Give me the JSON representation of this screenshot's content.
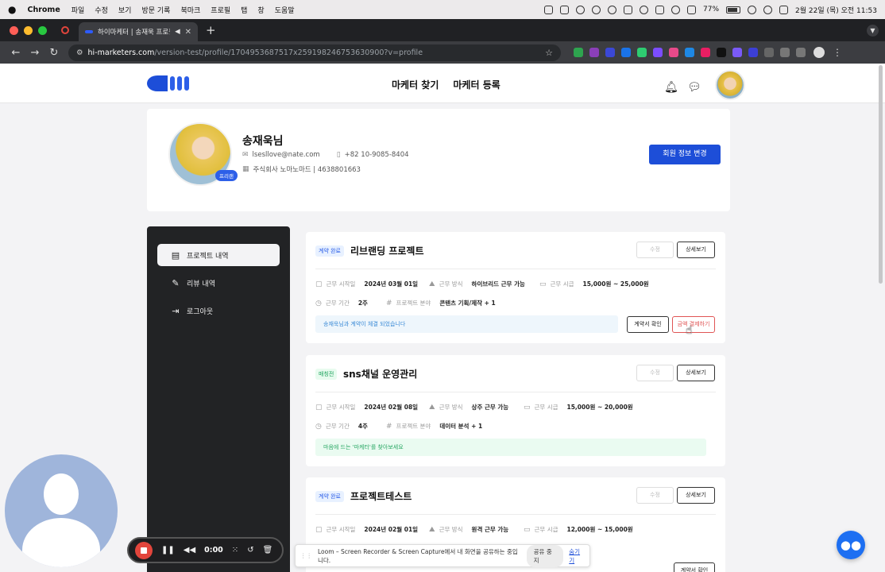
{
  "menubar": {
    "app": "Chrome",
    "items": [
      "파일",
      "수정",
      "보기",
      "방문 기록",
      "북마크",
      "프로필",
      "탭",
      "창",
      "도움말"
    ],
    "battery": "77%",
    "clock": "2월 22일 (목) 오전 11:53"
  },
  "browser": {
    "tab_title": "하이마케터 | 송재욱 프로필",
    "url_host": "hi-marketers.com",
    "url_rest": "/version-test/profile/1704953687517x259198246753630900?v=profile"
  },
  "header": {
    "nav": [
      "마케터 찾기",
      "마케터 등록"
    ]
  },
  "profile": {
    "name": "송재욱님",
    "email": "lsesllove@nate.com",
    "phone": "+82 10-9085-8404",
    "company": "주식회사 노마노마드 | 4638801663",
    "badge": "프리랜",
    "edit_button": "회원 정보 변경"
  },
  "sidebar": {
    "items": [
      {
        "label": "프로젝트 내역",
        "icon": "document-icon"
      },
      {
        "label": "리뷰 내역",
        "icon": "pencil-icon"
      },
      {
        "label": "로그아웃",
        "icon": "logout-icon"
      }
    ]
  },
  "labels": {
    "start_date": "근무 시작일",
    "work_type": "근무 방식",
    "hourly_rate": "근무 시급",
    "duration": "근무 기간",
    "field": "프로젝트 분야",
    "edit": "수정",
    "detail": "상세보기",
    "contract": "계약서 확인",
    "pay": "금액 결제하기"
  },
  "projects": [
    {
      "status": "계약 완료",
      "title": "리브랜딩 프로젝트",
      "start_date": "2024년 03월 01일",
      "work_type": "하이브리드 근무 가능",
      "rate": "15,000원 ~ 25,000원",
      "duration": "2주",
      "field": "콘텐츠 기획/제작 + 1",
      "notice": "송재욱님과 계약이 체결 되었습니다"
    },
    {
      "status": "매칭전",
      "title": "sns채널 운영관리",
      "start_date": "2024년 02월 08일",
      "work_type": "상주 근무 가능",
      "rate": "15,000원 ~ 20,000원",
      "duration": "4주",
      "field": "데이터 분석 + 1",
      "notice": "마음에 드는 '마케터'를 찾아보세요"
    },
    {
      "status": "계약 완료",
      "title": "프로젝트테스트",
      "start_date": "2024년 02월 01일",
      "work_type": "원격 근무 가능",
      "rate": "12,000원 ~ 15,000원"
    }
  ],
  "loom": {
    "timer": "0:00",
    "share_message": "Loom – Screen Recorder & Screen Capture에서 내 화면을 공유하는 중입니다.",
    "stop_share": "공유 중지",
    "hide": "숨기기"
  },
  "colors": {
    "accent": "#1d4ed8",
    "sidebar_bg": "#222325",
    "record_red": "#e2453c"
  }
}
